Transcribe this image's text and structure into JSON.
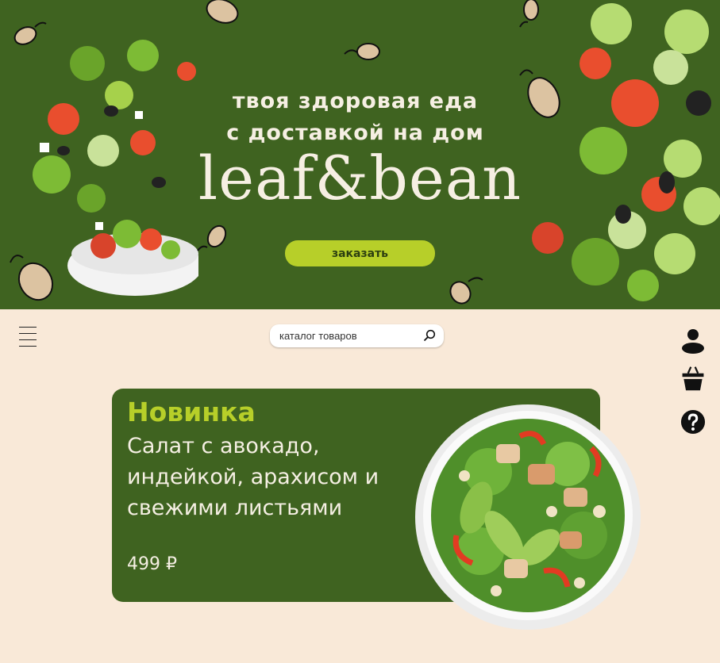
{
  "hero": {
    "tagline_line1": "твоя здоровая еда",
    "tagline_line2": "с доставкой на дом",
    "brand": "leaf&bean",
    "order_label": "заказать"
  },
  "toolbar": {
    "search_placeholder": "каталог товаров"
  },
  "promo": {
    "badge": "Новинка",
    "title": "Салат с авокадо, индейкой, арахисом и свежими листьями",
    "price": "499 ₽"
  },
  "colors": {
    "hero_bg": "#3f6320",
    "accent": "#b7cf29",
    "page_bg": "#f9e9d8"
  },
  "icons": [
    "menu-icon",
    "search-icon",
    "user-icon",
    "basket-icon",
    "help-icon",
    "bean-icon"
  ]
}
